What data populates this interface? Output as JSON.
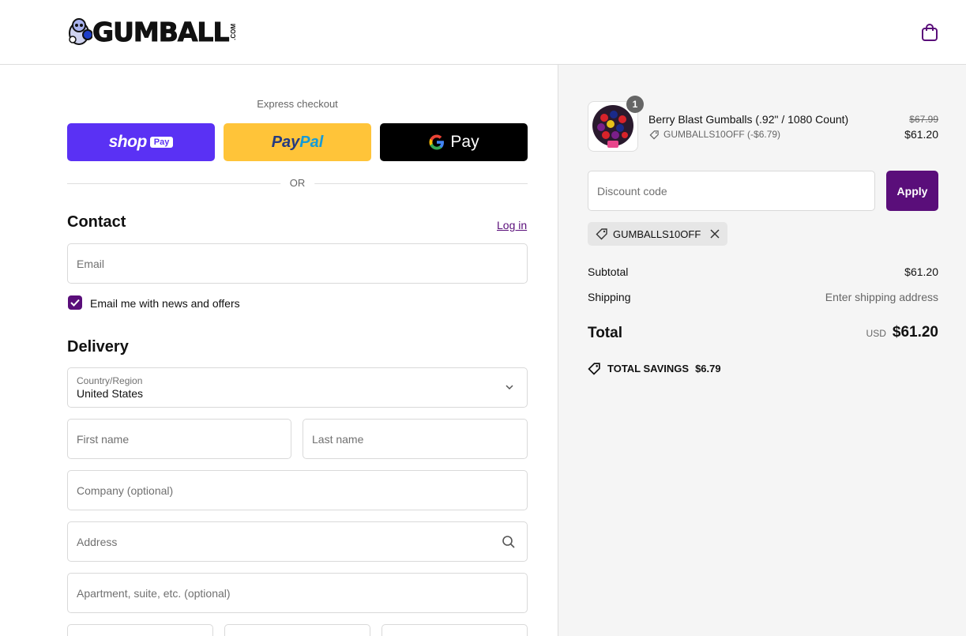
{
  "header": {
    "brand": "GUMBALL",
    "brand_suffix": ".COM",
    "cart_icon": "shopping-bag-icon"
  },
  "express": {
    "label": "Express checkout",
    "shop_pay": {
      "word": "shop",
      "badge": "Pay"
    },
    "paypal": {
      "part1": "Pay",
      "part2": "Pal"
    },
    "gpay": {
      "g": "G",
      "pay": "Pay"
    },
    "or_text": "OR"
  },
  "contact": {
    "title": "Contact",
    "login_link": "Log in",
    "email_placeholder": "Email",
    "newsletter_label": "Email me with news and offers",
    "newsletter_checked": true
  },
  "delivery": {
    "title": "Delivery",
    "country_label": "Country/Region",
    "country_value": "United States",
    "first_name_placeholder": "First name",
    "last_name_placeholder": "Last name",
    "company_placeholder": "Company (optional)",
    "address_placeholder": "Address",
    "apartment_placeholder": "Apartment, suite, etc. (optional)"
  },
  "summary": {
    "product": {
      "quantity": "1",
      "name": "Berry Blast Gumballs (.92\" / 1080 Count)",
      "discount_code_line": "GUMBALLS10OFF (-$6.79)",
      "original_price": "$67.99",
      "price": "$61.20"
    },
    "discount": {
      "placeholder": "Discount code",
      "apply_label": "Apply",
      "applied_code": "GUMBALLS10OFF"
    },
    "subtotal_label": "Subtotal",
    "subtotal_value": "$61.20",
    "shipping_label": "Shipping",
    "shipping_value": "Enter shipping address",
    "total_label": "Total",
    "currency": "USD",
    "total_value": "$61.20",
    "savings_label": "TOTAL SAVINGS",
    "savings_value": "$6.79"
  },
  "colors": {
    "accent": "#5a0e7a",
    "shop_pay": "#5a31f4",
    "paypal": "#ffc439",
    "gpay": "#000000"
  }
}
